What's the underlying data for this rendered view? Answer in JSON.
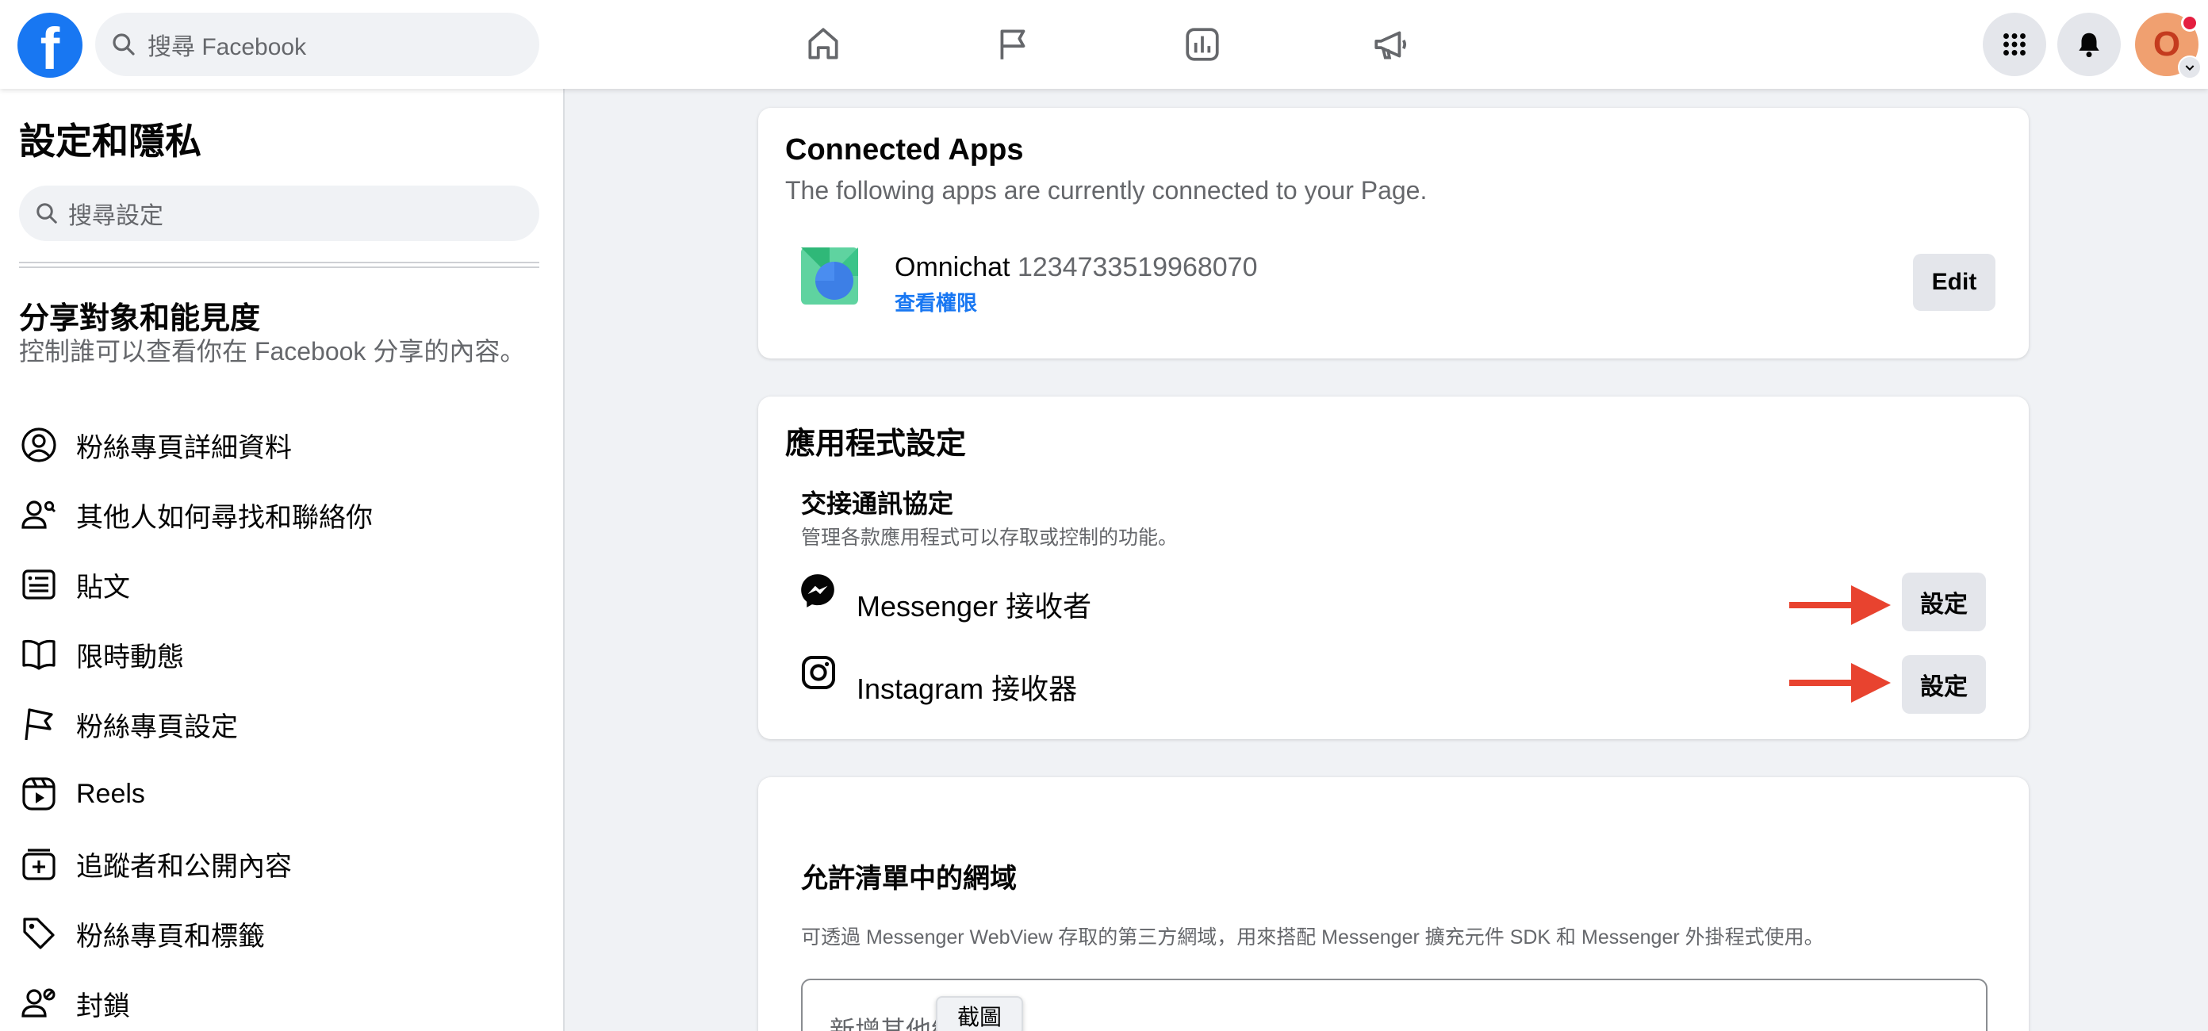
{
  "topbar": {
    "logo_letter": "f",
    "search_placeholder": "搜尋 Facebook",
    "nav_icons": [
      "home-icon",
      "flag-icon",
      "insights-icon",
      "megaphone-icon"
    ],
    "right_icons": [
      "apps-grid-icon",
      "bell-icon"
    ],
    "avatar_letter": "O"
  },
  "sidebar": {
    "title": "設定和隱私",
    "search_placeholder": "搜尋設定",
    "section_title": "分享對象和能見度",
    "section_desc": "控制誰可以查看你在 Facebook 分享的內容。",
    "items": [
      {
        "label": "粉絲專頁詳細資料",
        "icon": "person-circle-icon"
      },
      {
        "label": "其他人如何尋找和聯絡你",
        "icon": "people-search-icon"
      },
      {
        "label": "貼文",
        "icon": "post-icon"
      },
      {
        "label": "限時動態",
        "icon": "book-open-icon"
      },
      {
        "label": "粉絲專頁設定",
        "icon": "flag-icon"
      },
      {
        "label": "Reels",
        "icon": "reels-icon"
      },
      {
        "label": "追蹤者和公開內容",
        "icon": "add-box-icon"
      },
      {
        "label": "粉絲專頁和標籤",
        "icon": "tag-icon"
      },
      {
        "label": "封鎖",
        "icon": "block-person-icon"
      }
    ]
  },
  "connected_apps": {
    "title": "Connected Apps",
    "subtitle": "The following apps are currently connected to your Page.",
    "app_name": "Omnichat",
    "app_id": "1234733519968070",
    "permissions_link": "查看權限",
    "edit_label": "Edit"
  },
  "app_settings": {
    "title": "應用程式設定",
    "protocol_title": "交接通訊協定",
    "protocol_desc": "管理各款應用程式可以存取或控制的功能。",
    "rows": [
      {
        "label": "Messenger 接收者",
        "icon": "messenger-icon",
        "button": "設定"
      },
      {
        "label": "Instagram 接收器",
        "icon": "instagram-icon",
        "button": "設定"
      }
    ],
    "arrow_color": "#e8432f"
  },
  "whitelist": {
    "title": "允許清單中的網域",
    "desc": "可透過 Messenger WebView 存取的第三方網域，用來搭配 Messenger 擴充元件 SDK 和 Messenger 外掛程式使用。",
    "input_placeholder": "新增其他網域"
  },
  "tooltip": "截圖",
  "colors": {
    "brand": "#1877f2",
    "arrow": "#e8432f"
  }
}
